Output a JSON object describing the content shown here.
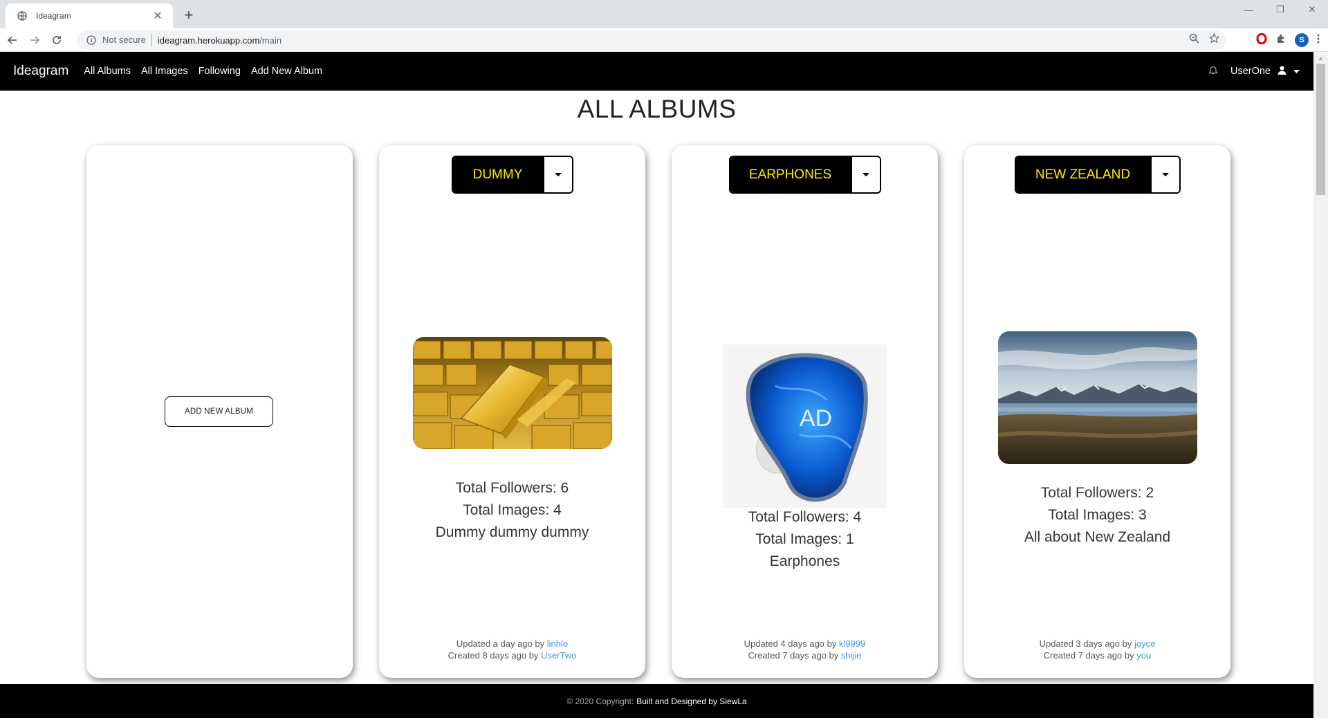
{
  "browser": {
    "tab_title": "Ideagram",
    "not_secure": "Not secure",
    "url_host": "ideagram.herokuapp.com",
    "url_path": "/main",
    "profile_initial": "S"
  },
  "site": {
    "brand": "Ideagram",
    "nav_links": [
      "All Albums",
      "All Images",
      "Following",
      "Add New Album"
    ],
    "username": "UserOne"
  },
  "page": {
    "title": "ALL ALBUMS",
    "add_button": "ADD NEW ALBUM"
  },
  "albums": [
    {
      "name": "DUMMY",
      "followers": "Total Followers: 6",
      "images": "Total Images: 4",
      "description": "Dummy dummy dummy",
      "updated_prefix": "Updated a day ago by ",
      "updated_by": "linhlo",
      "created_prefix": "Created 8 days ago by ",
      "created_by": "UserTwo"
    },
    {
      "name": "EARPHONES",
      "followers": "Total Followers: 4",
      "images": "Total Images: 1",
      "description": "Earphones",
      "updated_prefix": "Updated 4 days ago by ",
      "updated_by": "kl9999",
      "created_prefix": "Created 7 days ago by ",
      "created_by": "shijie"
    },
    {
      "name": "NEW ZEALAND",
      "followers": "Total Followers: 2",
      "images": "Total Images: 3",
      "description": "All about New Zealand",
      "updated_prefix": "Updated 3 days ago by ",
      "updated_by": "joyce",
      "created_prefix": "Created 7 days ago by ",
      "created_by": "you"
    }
  ],
  "earphone_logo": "AD",
  "footer": {
    "copyright": "© 2020 Copyright:",
    "credit": "Built and Designed by SiewLa"
  },
  "colors": {
    "navbar": "#000000",
    "album_button_text": "#ffeb00",
    "link": "#4a90e2"
  }
}
